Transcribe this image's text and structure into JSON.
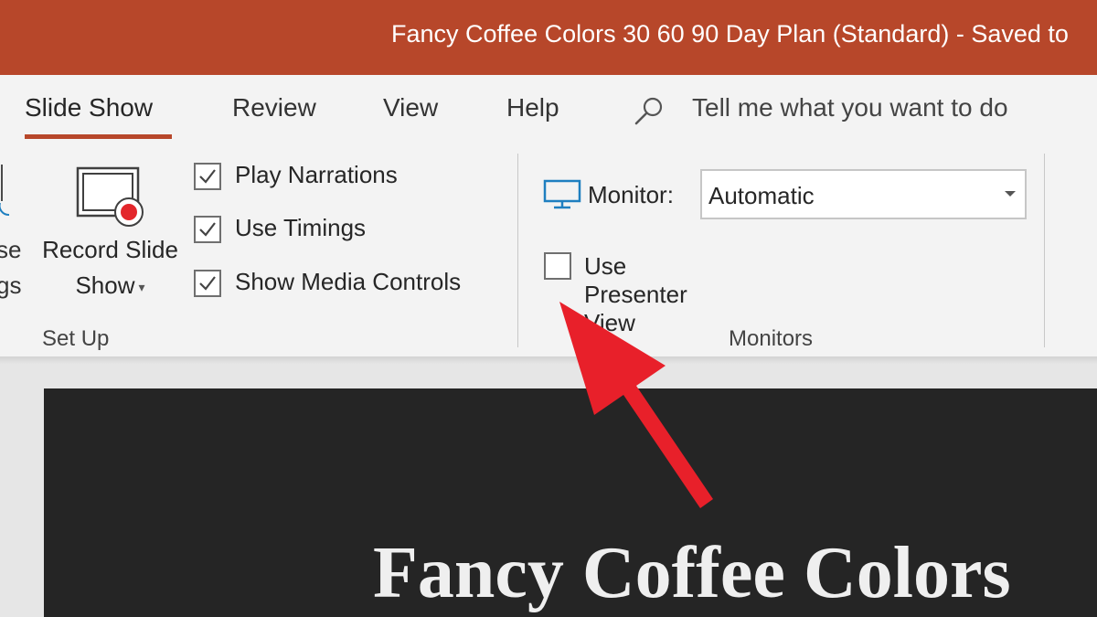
{
  "window": {
    "title": "Fancy Coffee Colors 30 60 90 Day Plan (Standard)  -  Saved to"
  },
  "tabs": [
    {
      "label": "Slide Show",
      "active": true
    },
    {
      "label": "Review",
      "active": false
    },
    {
      "label": "View",
      "active": false
    },
    {
      "label": "Help",
      "active": false
    }
  ],
  "tell_me": {
    "icon": "search-icon",
    "text": "Tell me what you want to do"
  },
  "ribbon": {
    "partial_button": {
      "line1": "se",
      "line2": "gs"
    },
    "record_slide_show": {
      "line1": "Record Slide",
      "line2": "Show",
      "icon": "record-slide-show-icon"
    },
    "checkboxes": [
      {
        "label": "Play Narrations",
        "checked": true
      },
      {
        "label": "Use Timings",
        "checked": true
      },
      {
        "label": "Show Media Controls",
        "checked": true
      }
    ],
    "setup_group_label": "Set Up",
    "monitor": {
      "icon": "monitor-icon",
      "label": "Monitor:",
      "selected": "Automatic"
    },
    "presenter_view": {
      "label": "Use Presenter View",
      "checked": false
    },
    "monitors_group_label": "Monitors"
  },
  "slide": {
    "title": "Fancy Coffee Colors"
  },
  "colors": {
    "accent": "#b7472a",
    "annotation_arrow": "#e8202a",
    "monitor_icon": "#1e7fc0",
    "record_dot": "#e3262b"
  }
}
